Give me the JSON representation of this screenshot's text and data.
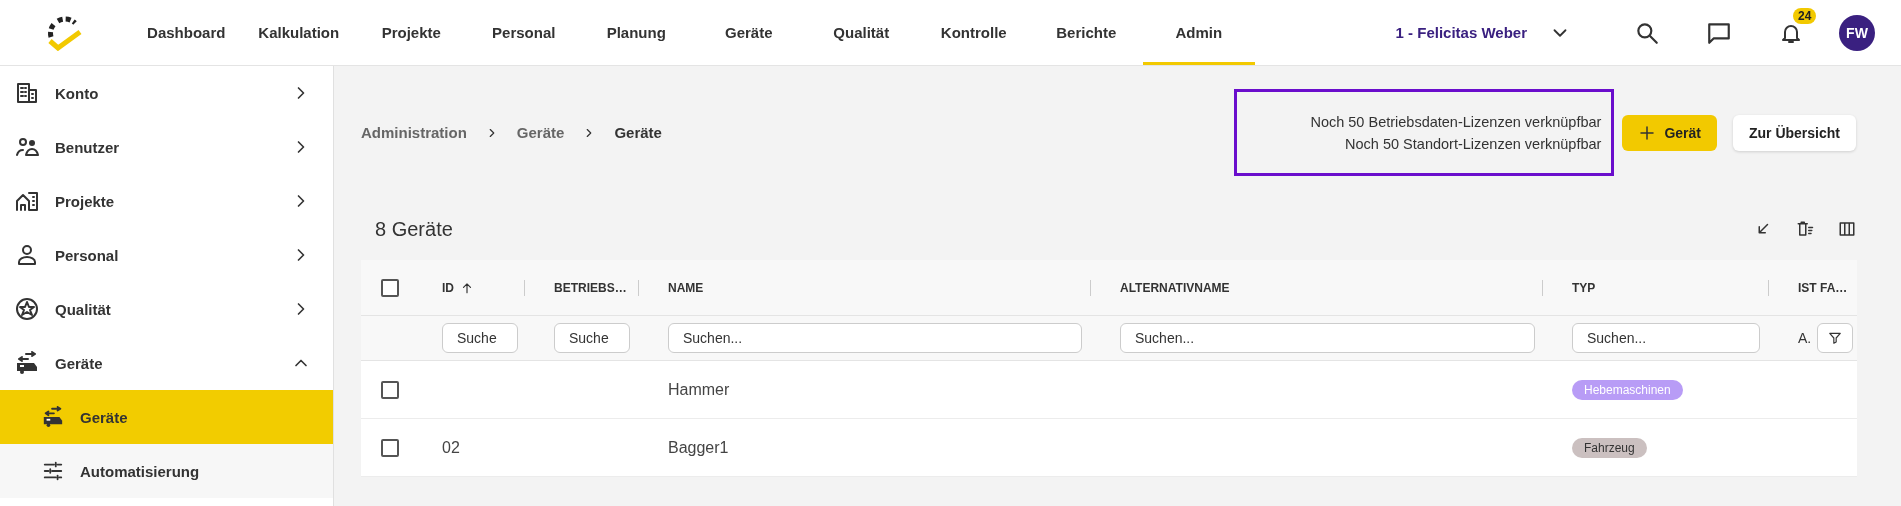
{
  "topbar": {
    "nav": [
      {
        "label": "Dashboard",
        "selected": false
      },
      {
        "label": "Kalkulation",
        "selected": false
      },
      {
        "label": "Projekte",
        "selected": false
      },
      {
        "label": "Personal",
        "selected": false
      },
      {
        "label": "Planung",
        "selected": false
      },
      {
        "label": "Geräte",
        "selected": false
      },
      {
        "label": "Qualität",
        "selected": false
      },
      {
        "label": "Kontrolle",
        "selected": false
      },
      {
        "label": "Berichte",
        "selected": false
      },
      {
        "label": "Admin",
        "selected": true
      }
    ],
    "user": "1 - Felicitas Weber",
    "notifications": "24",
    "avatar": "FW"
  },
  "sidebar": {
    "items": [
      {
        "label": "Konto",
        "expanded": false
      },
      {
        "label": "Benutzer",
        "expanded": false
      },
      {
        "label": "Projekte",
        "expanded": false
      },
      {
        "label": "Personal",
        "expanded": false
      },
      {
        "label": "Qualität",
        "expanded": false
      },
      {
        "label": "Geräte",
        "expanded": true,
        "children": [
          {
            "label": "Geräte",
            "selected": true
          },
          {
            "label": "Automatisierung",
            "selected": false
          }
        ]
      }
    ]
  },
  "breadcrumb": [
    "Administration",
    "Geräte",
    "Geräte"
  ],
  "license_notes": [
    "Noch 50 Betriebsdaten-Lizenzen verknüpfbar",
    "Noch 50 Standort-Lizenzen verknüpfbar"
  ],
  "buttons": [
    {
      "label": "Gerät",
      "kind": "primary"
    },
    {
      "label": "Zur Übersicht",
      "kind": "secondary"
    }
  ],
  "table": {
    "title": "8 Geräte",
    "all_checked": false,
    "columns": [
      {
        "label": "ID",
        "sorted": true
      },
      {
        "label": "BETRIEBS…",
        "sorted": false
      },
      {
        "label": "NAME",
        "sorted": false
      },
      {
        "label": "ALTERNATIVNAME",
        "sorted": false
      },
      {
        "label": "TYP",
        "sorted": false
      },
      {
        "label": "IST FA…",
        "sorted": false
      }
    ],
    "filters": [
      {
        "kind": "text",
        "placeholder": "Suche"
      },
      {
        "kind": "text",
        "placeholder": "Suche"
      },
      {
        "kind": "text",
        "placeholder": "Suchen..."
      },
      {
        "kind": "text",
        "placeholder": "Suchen..."
      },
      {
        "kind": "text",
        "placeholder": "Suchen..."
      },
      {
        "kind": "select",
        "value": "A."
      }
    ],
    "rows": [
      {
        "checked": false,
        "name": "Hammer",
        "type": {
          "label": "Hebemaschinen",
          "color": "#b89cf6"
        }
      },
      {
        "checked": false,
        "id": "02",
        "name": "Bagger1",
        "type": {
          "label": "Fahrzeug",
          "color": "#cbc0c0"
        }
      }
    ]
  }
}
